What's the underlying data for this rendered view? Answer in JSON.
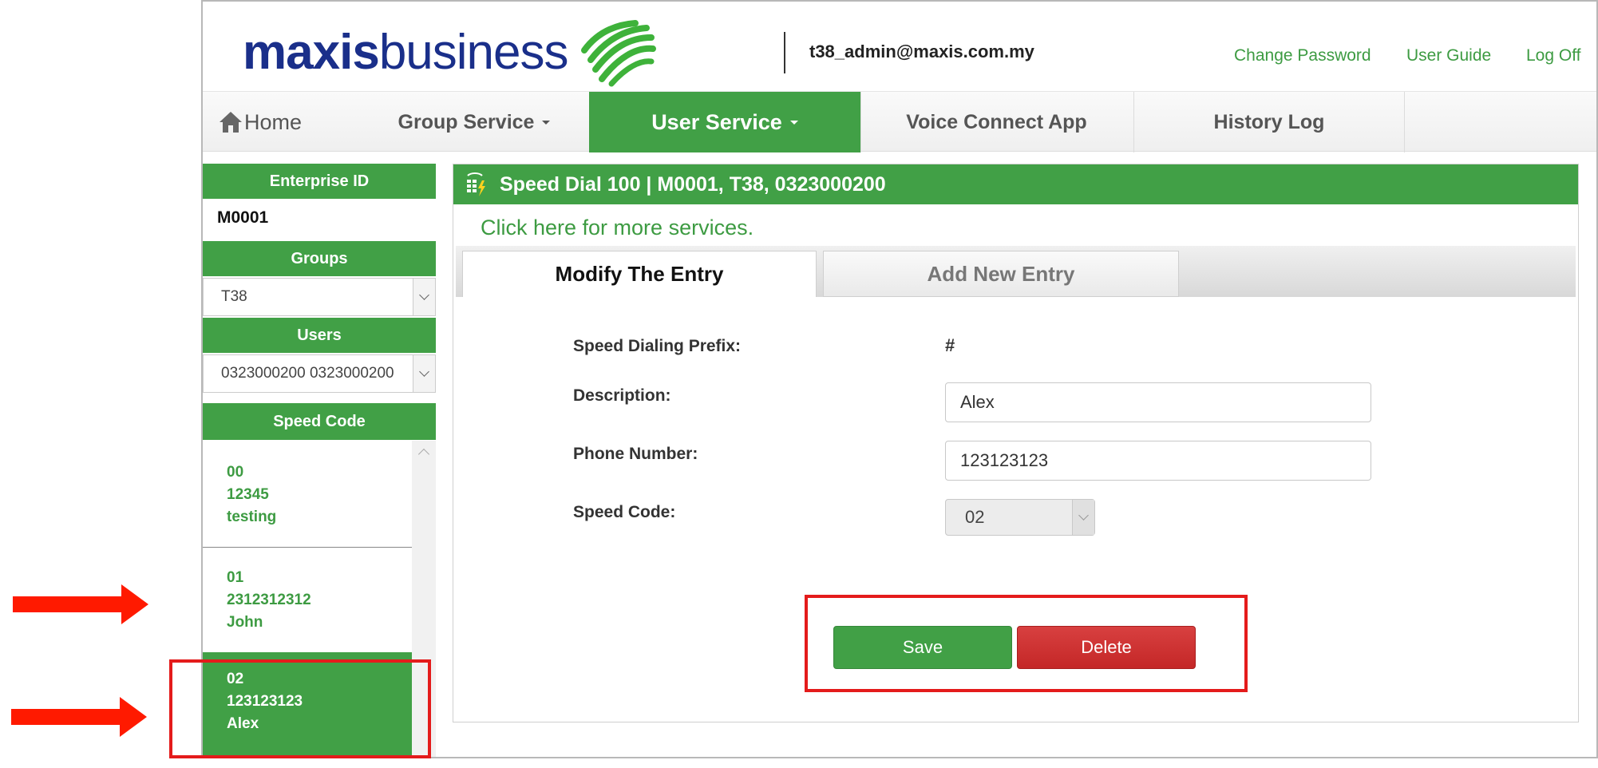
{
  "brand": {
    "name_bold": "maxis",
    "name_light": "business",
    "colors": {
      "green": "#41a046",
      "navy": "#1a2f8a",
      "red": "#c42727",
      "annotation": "#e41b1b"
    }
  },
  "header": {
    "user_email": "t38_admin@maxis.com.my",
    "links": {
      "change_password": "Change Password",
      "user_guide": "User Guide",
      "log_off": "Log Off"
    }
  },
  "nav": {
    "home": "Home",
    "group_service": "Group Service",
    "user_service": "User Service",
    "voice_connect": "Voice Connect App",
    "history_log": "History Log",
    "active": "User Service"
  },
  "sidebar": {
    "enterprise_label": "Enterprise ID",
    "enterprise_value": "M0001",
    "groups_label": "Groups",
    "groups_value": "T38",
    "users_label": "Users",
    "users_value": "0323000200 0323000200",
    "speed_label": "Speed Code",
    "speed_items": [
      {
        "code": "00",
        "number": "12345",
        "name": "testing"
      },
      {
        "code": "01",
        "number": "2312312312",
        "name": "John"
      },
      {
        "code": "02",
        "number": "123123123",
        "name": "Alex"
      }
    ],
    "selected_index": 2
  },
  "panel": {
    "title": "Speed Dial 100 | M0001, T38, 0323000200",
    "more_link": "Click here for more services.",
    "tabs": {
      "modify": "Modify The Entry",
      "add": "Add New Entry"
    },
    "fields": {
      "prefix_label": "Speed Dialing Prefix:",
      "prefix_value": "#",
      "description_label": "Description:",
      "description_value": "Alex",
      "phone_label": "Phone Number:",
      "phone_value": "123123123",
      "code_label": "Speed Code:",
      "code_value": "02"
    },
    "buttons": {
      "save": "Save",
      "delete": "Delete"
    }
  },
  "icons": [
    "home-icon",
    "phone-keypad-icon",
    "chevron-down-icon",
    "chevron-up-icon",
    "red-arrow-icon"
  ]
}
